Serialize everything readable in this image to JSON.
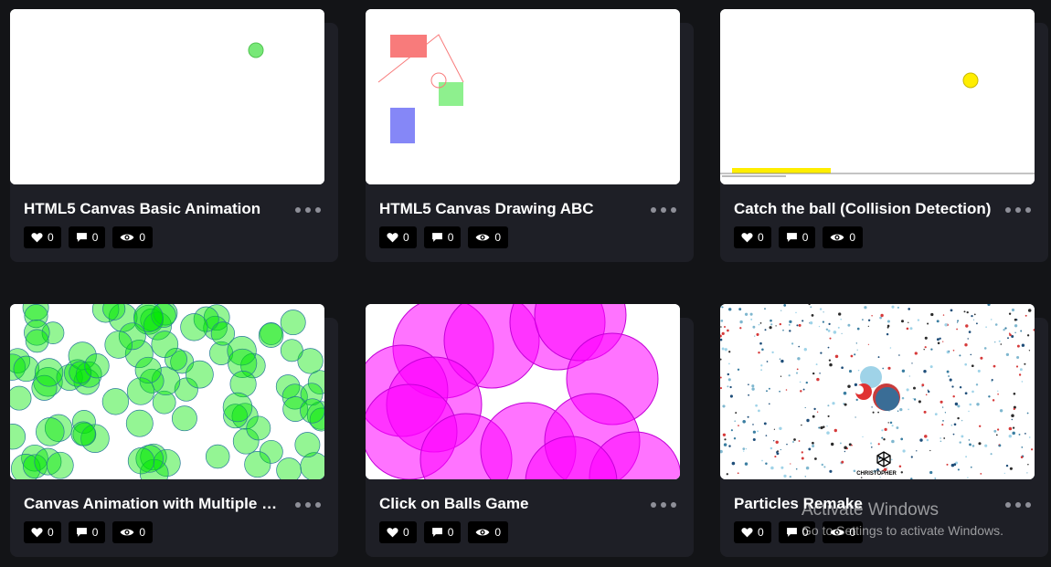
{
  "cards": [
    {
      "title": "HTML5 Canvas Basic Animation",
      "likes": "0",
      "comments": "0",
      "views": "0"
    },
    {
      "title": "HTML5 Canvas Drawing ABC",
      "likes": "0",
      "comments": "0",
      "views": "0"
    },
    {
      "title": "Catch the ball (Collision Detection)",
      "likes": "0",
      "comments": "0",
      "views": "0"
    },
    {
      "title": "Canvas Animation with Multiple Objects",
      "likes": "0",
      "comments": "0",
      "views": "0"
    },
    {
      "title": "Click on Balls Game",
      "likes": "0",
      "comments": "0",
      "views": "0"
    },
    {
      "title": "Particles Remake",
      "likes": "0",
      "comments": "0",
      "views": "0",
      "preview_label": "CHRISTOPHER"
    }
  ],
  "icons": {
    "like": "heart-icon",
    "comment": "comment-icon",
    "view": "eye-icon",
    "more": "more-dots-icon"
  },
  "colors": {
    "page_bg": "#131417",
    "card_bg": "#1e1f26",
    "badge_bg": "#000000",
    "green": "#00e600",
    "magenta": "#ff00ff",
    "yellow": "#ffee00"
  },
  "watermark": {
    "title": "Activate Windows",
    "subtitle": "Go to Settings to activate Windows."
  }
}
